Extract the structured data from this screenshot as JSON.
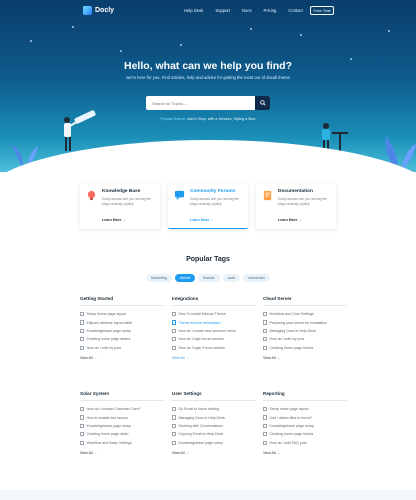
{
  "nav": {
    "logo": "Docly",
    "links": [
      "Help Desk",
      "Support",
      "Docs",
      "Pricing",
      "Contact"
    ],
    "cta": "Free Trial"
  },
  "hero": {
    "title": "Hello, what can we help you find?",
    "subtitle": "we're here for you. Find articles, help and advice for getting the most our of docall theme",
    "search_placeholder": "Search for Topics....",
    "popular_prefix": "Popular Search:",
    "popular_terms": "Add a Shop, with a Vendors, Styling a Blue"
  },
  "cards": [
    {
      "title": "Knowledge Base",
      "desc": "Docly layouts are you seeing the plays charddy quality.",
      "more": "Learn More"
    },
    {
      "title": "Community Forums",
      "desc": "Docly layouts are you seeing the plays charddy quality.",
      "more": "Learn More"
    },
    {
      "title": "Documentation",
      "desc": "Docly layouts are you seeing the plays charddy quality.",
      "more": "Learn More"
    }
  ],
  "tags_title": "Popular Tags",
  "tags": [
    "Marketing",
    "Abbott",
    "Brands",
    "code",
    "ohmanses"
  ],
  "categories": [
    {
      "title": "Getting Started",
      "items": [
        "Setup Home page layout",
        "Ellipses attribute layout table",
        "Knowledgebase page setup",
        "Creating home page sliders",
        "How do I edit my post"
      ],
      "view_all": "View All"
    },
    {
      "title": "Integrations",
      "items": [
        "How To Install Manual Theme",
        "Theme license information",
        "How do I create new structure menu",
        "How do I login forum section",
        "How do I login Forum section"
      ],
      "view_all": "View All"
    },
    {
      "title": "Cloud Server",
      "items": [
        "Workflow and Cron Settings",
        "Preparing your server for installation",
        "Managing Docs in Help Desk",
        "How do I edit my post",
        "Creating home page blocks"
      ],
      "view_all": "View All"
    },
    {
      "title": "Solar System",
      "items": [
        "How do I contact Customer Care?",
        "How to enable two factors",
        "Knowledgebase page setup",
        "Creating home page slider",
        "Workflow and Basic Settings"
      ],
      "view_all": "View All"
    },
    {
      "title": "User Settings",
      "items": [
        "Do Email to forum setting",
        "Managing Docs in Help Desk",
        "Working with Conversations",
        "Copying Email to Help Desk",
        "Knowledgebase page setup"
      ],
      "view_all": "View All"
    },
    {
      "title": "Reporting",
      "items": [
        "Setup home page layout",
        "Can I attach files to forms?",
        "Knowledgebase page setup",
        "Creating home page blocks",
        "How do I add FAQ post"
      ],
      "view_all": "View All"
    }
  ],
  "colors": {
    "accent": "#1d9bf0",
    "hero_dark": "#0a3d6b",
    "hero_light": "#4dc0db"
  }
}
